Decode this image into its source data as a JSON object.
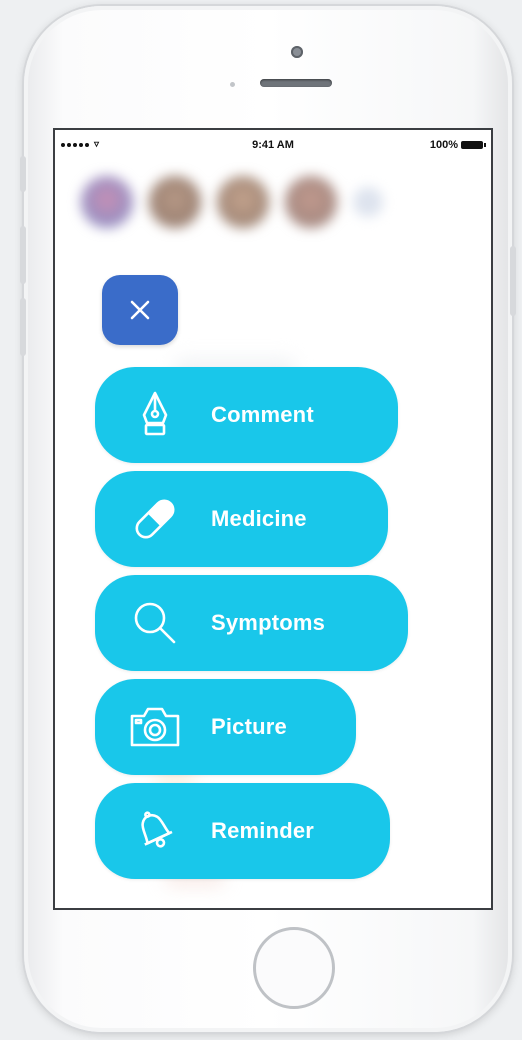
{
  "status_bar": {
    "time": "9:41 AM",
    "battery": "100%"
  },
  "close_button": {
    "icon": "close-icon"
  },
  "menu": {
    "items": [
      {
        "label": "Comment",
        "icon": "pen-nib-icon"
      },
      {
        "label": "Medicine",
        "icon": "pill-icon"
      },
      {
        "label": "Symptoms",
        "icon": "magnifier-icon"
      },
      {
        "label": "Picture",
        "icon": "camera-icon"
      },
      {
        "label": "Reminder",
        "icon": "bell-icon"
      }
    ]
  },
  "colors": {
    "menu_button": "#19c7ea",
    "close_button": "#3a6cc9",
    "text": "#ffffff"
  }
}
